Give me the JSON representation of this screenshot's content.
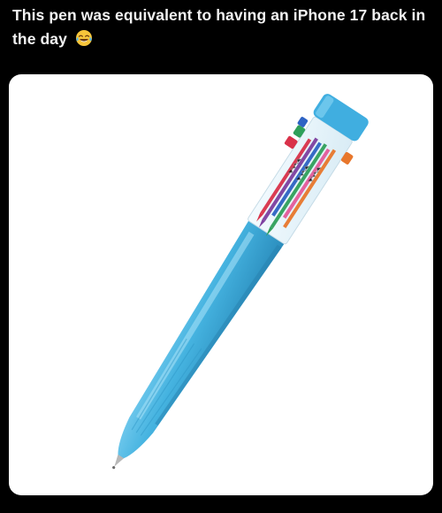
{
  "post": {
    "text": "This pen was equivalent to having an iPhone 17 back in the day",
    "emoji": "face-with-tears-of-joy-icon"
  },
  "media": {
    "icon": "ten-color-pen-icon",
    "background": "#ffffff",
    "colors": {
      "barrel": "#45b3e0",
      "barrel_shadow": "#2e95c4",
      "barrel_highlight": "#8ad6f3",
      "cap": "#40aee0",
      "tab_red": "#d9324a",
      "tab_purple": "#7d3fa0",
      "tab_green": "#2fa05a",
      "tab_orange": "#e8772c",
      "tab_blue": "#2d63c4",
      "tab_pink": "#e45a9a"
    }
  }
}
